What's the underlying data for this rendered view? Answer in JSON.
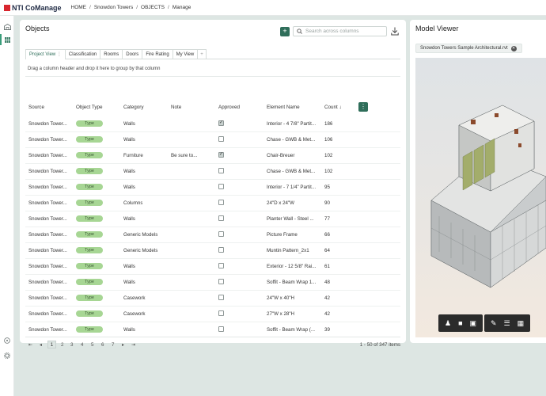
{
  "app": {
    "name": "NTI CoManage"
  },
  "breadcrumb": [
    "HOME",
    "Snowdon Towers",
    "OBJECTS",
    "Manage"
  ],
  "objects": {
    "title": "Objects",
    "search_placeholder": "Search across columns",
    "tabs": [
      {
        "label": "Project View",
        "active": true
      },
      {
        "label": "Classification"
      },
      {
        "label": "Rooms"
      },
      {
        "label": "Doors"
      },
      {
        "label": "Fire Rating"
      },
      {
        "label": "My View"
      },
      {
        "label": "+"
      }
    ],
    "group_hint": "Drag a column header and drop it here to group by that column",
    "columns": [
      "Source",
      "Object Type",
      "Category",
      "Note",
      "Approved",
      "Element Name",
      "Count ↓"
    ],
    "rows": [
      {
        "source": "Snowdon Tower...",
        "type": "Type",
        "category": "Walls",
        "note": "",
        "approved": true,
        "element": "Interior - 4 7/8\" Partit...",
        "count": "186"
      },
      {
        "source": "Snowdon Tower...",
        "type": "Type",
        "category": "Walls",
        "note": "",
        "approved": false,
        "element": "Chase - GWB & Met...",
        "count": "106"
      },
      {
        "source": "Snowdon Tower...",
        "type": "Type",
        "category": "Furniture",
        "note": "Be sure to...",
        "approved": true,
        "element": "Chair-Breuer",
        "count": "102"
      },
      {
        "source": "Snowdon Tower...",
        "type": "Type",
        "category": "Walls",
        "note": "",
        "approved": false,
        "element": "Chase - GWB & Met...",
        "count": "102"
      },
      {
        "source": "Snowdon Tower...",
        "type": "Type",
        "category": "Walls",
        "note": "",
        "approved": false,
        "element": "Interior - 7 1/4\" Partit...",
        "count": "95"
      },
      {
        "source": "Snowdon Tower...",
        "type": "Type",
        "category": "Columns",
        "note": "",
        "approved": false,
        "element": "24\"D x 24\"W",
        "count": "90"
      },
      {
        "source": "Snowdon Tower...",
        "type": "Type",
        "category": "Walls",
        "note": "",
        "approved": false,
        "element": "Planter Wall - Steel ...",
        "count": "77"
      },
      {
        "source": "Snowdon Tower...",
        "type": "Type",
        "category": "Generic Models",
        "note": "",
        "approved": false,
        "element": "Picture Frame",
        "count": "66"
      },
      {
        "source": "Snowdon Tower...",
        "type": "Type",
        "category": "Generic Models",
        "note": "",
        "approved": false,
        "element": "Muntin Pattern_2x1",
        "count": "64"
      },
      {
        "source": "Snowdon Tower...",
        "type": "Type",
        "category": "Walls",
        "note": "",
        "approved": false,
        "element": "Exterior - 12 5/8\" Rai...",
        "count": "61"
      },
      {
        "source": "Snowdon Tower...",
        "type": "Type",
        "category": "Walls",
        "note": "",
        "approved": false,
        "element": "Soffit - Beam Wrap 1...",
        "count": "48"
      },
      {
        "source": "Snowdon Tower...",
        "type": "Type",
        "category": "Casework",
        "note": "",
        "approved": false,
        "element": "24\"W x 40\"H",
        "count": "42"
      },
      {
        "source": "Snowdon Tower...",
        "type": "Type",
        "category": "Casework",
        "note": "",
        "approved": false,
        "element": "27\"W x 28\"H",
        "count": "42"
      },
      {
        "source": "Snowdon Tower...",
        "type": "Type",
        "category": "Walls",
        "note": "",
        "approved": false,
        "element": "Soffit - Beam Wrap (...",
        "count": "39"
      }
    ],
    "pagination": {
      "first": "⇤",
      "prev": "◂",
      "pages": [
        "1",
        "2",
        "3",
        "4",
        "5",
        "6",
        "7"
      ],
      "current_page": "1",
      "next": "▸",
      "last": "⇥",
      "info": "1 - 50 of 347 items"
    }
  },
  "model_viewer": {
    "title": "Model Viewer",
    "file_chip": "Snowdon Towers Sample Architectural.rvt"
  },
  "colors": {
    "brand_red": "#d8262e",
    "accent_green": "#2f6e5a",
    "pill_green": "#a7d694"
  }
}
